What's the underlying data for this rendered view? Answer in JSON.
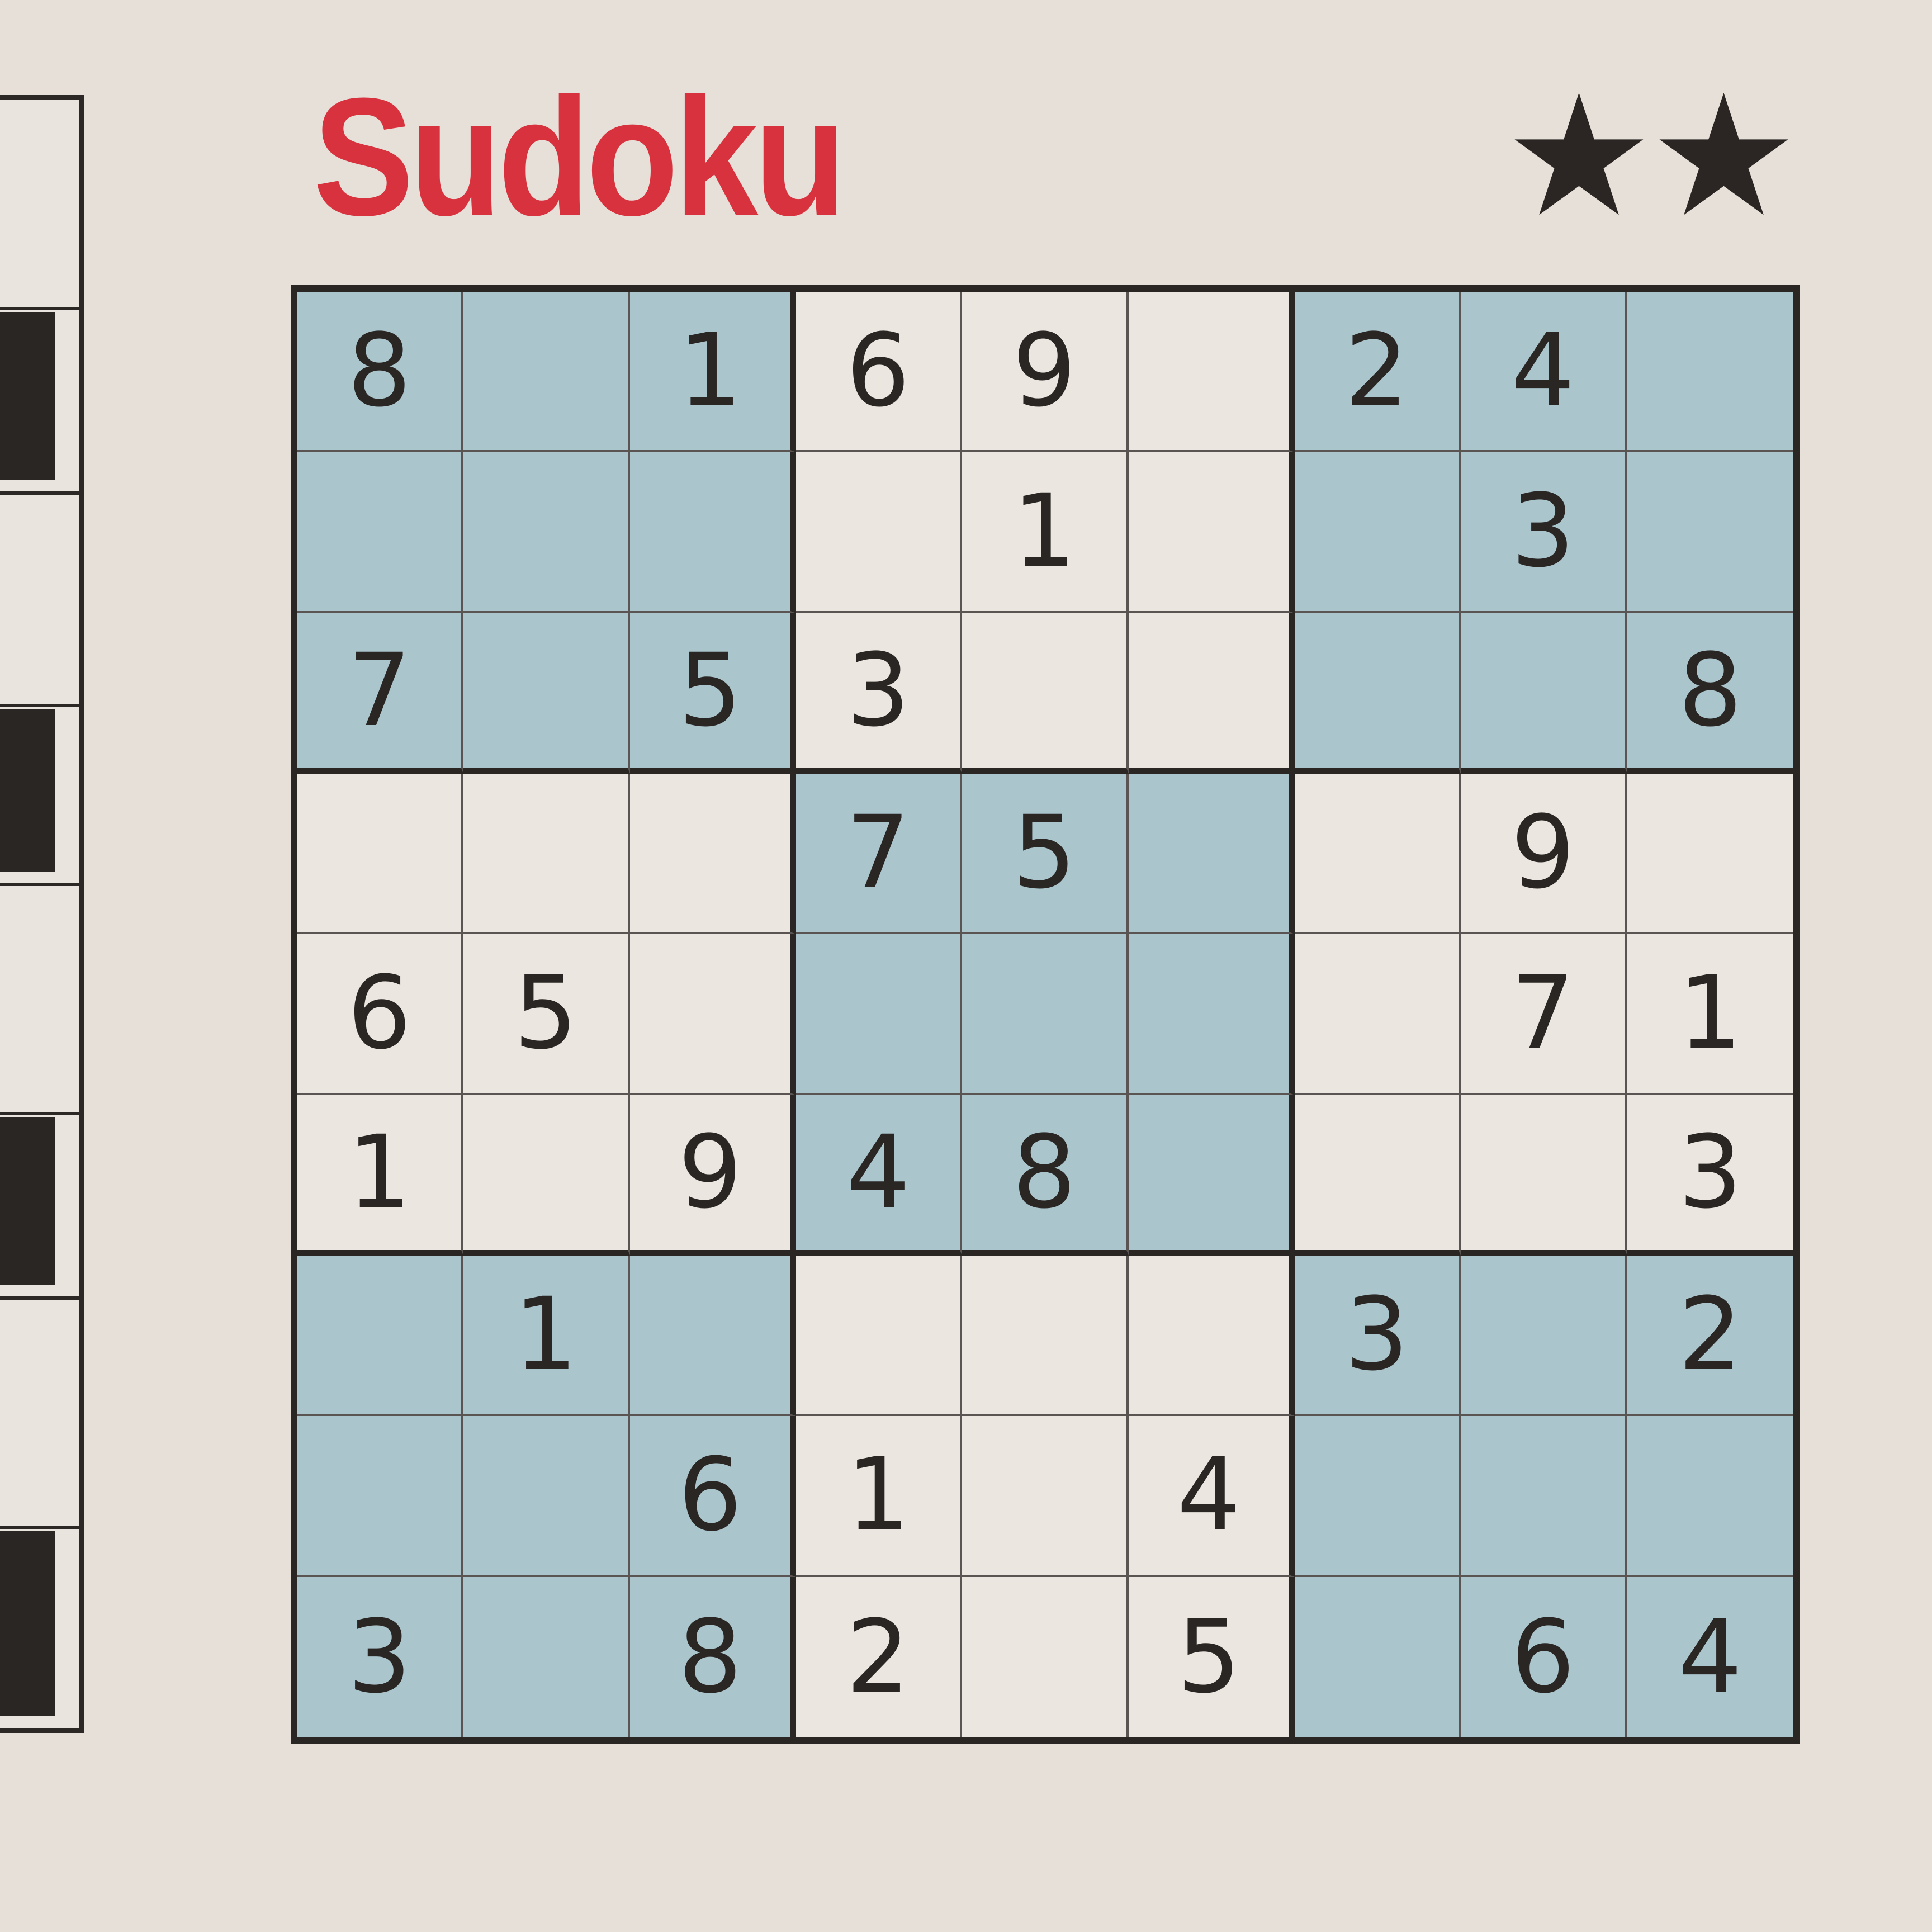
{
  "title": "Sudoku",
  "difficulty": {
    "stars": 2,
    "label": "★★"
  },
  "colors": {
    "title": "#d8323f",
    "shaded_box": "#aac5cc",
    "paper": "#e6e0d8",
    "ink": "#2a2624"
  },
  "shaded_boxes": [
    0,
    2,
    4,
    6,
    8
  ],
  "grid": [
    [
      "8",
      "",
      "1",
      "6",
      "9",
      "",
      "2",
      "4",
      ""
    ],
    [
      "",
      "",
      "",
      "",
      "1",
      "",
      "",
      "3",
      ""
    ],
    [
      "7",
      "",
      "5",
      "3",
      "",
      "",
      "",
      "",
      "8"
    ],
    [
      "",
      "",
      "",
      "7",
      "5",
      "",
      "",
      "9",
      ""
    ],
    [
      "6",
      "5",
      "",
      "",
      "",
      "",
      "",
      "7",
      "1"
    ],
    [
      "1",
      "",
      "9",
      "4",
      "8",
      "",
      "",
      "",
      "3"
    ],
    [
      "",
      "1",
      "",
      "",
      "",
      "",
      "3",
      "",
      "2"
    ],
    [
      "",
      "",
      "6",
      "1",
      "",
      "4",
      "",
      "",
      ""
    ],
    [
      "3",
      "",
      "8",
      "2",
      "",
      "5",
      "",
      "6",
      "4"
    ]
  ]
}
